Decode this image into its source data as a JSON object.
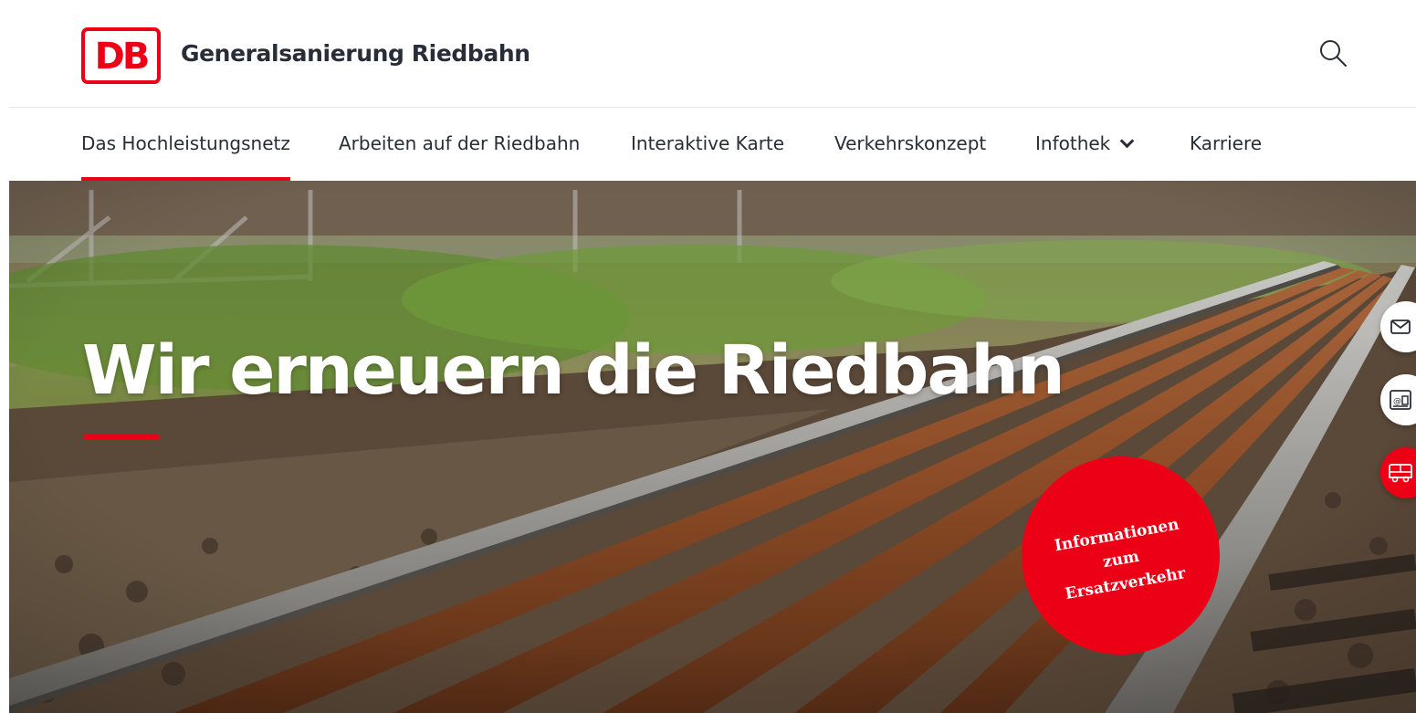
{
  "brand": {
    "logo_text": "DB",
    "site_title": "Generalsanierung Riedbahn"
  },
  "header": {
    "search_icon": "search-icon"
  },
  "nav": {
    "items": [
      {
        "label": "Das Hochleistungsnetz",
        "active": true
      },
      {
        "label": "Arbeiten auf der Riedbahn",
        "active": false
      },
      {
        "label": "Interaktive Karte",
        "active": false
      },
      {
        "label": "Verkehrskonzept",
        "active": false
      },
      {
        "label": "Infothek",
        "active": false,
        "has_dropdown": true
      },
      {
        "label": "Karriere",
        "active": false
      }
    ]
  },
  "hero": {
    "title": "Wir erneuern die Riedbahn",
    "badge_line1": "Informationen",
    "badge_line2": "zum",
    "badge_line3": "Ersatzverkehr"
  },
  "side_actions": [
    {
      "icon": "mail-icon"
    },
    {
      "icon": "newsletter-icon"
    },
    {
      "icon": "bus-icon"
    }
  ],
  "colors": {
    "brand_red": "#ec0016",
    "text_dark": "#282d37",
    "divider": "#e3e5e8"
  }
}
